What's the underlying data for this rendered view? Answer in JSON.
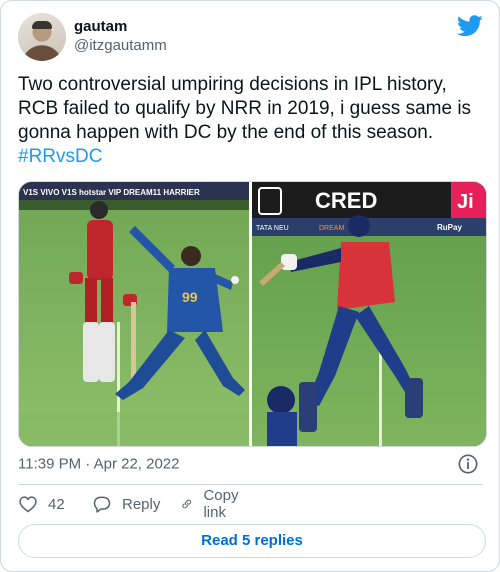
{
  "author": {
    "display_name": "gautam",
    "handle": "@itzgautamm"
  },
  "tweet": {
    "text": "Two controversial umpiring decisions in IPL history, RCB failed to qualify by NRR in 2019, i guess same is gonna happen with DC by the end of this season. ",
    "hashtag": "#RRvsDC"
  },
  "media": {
    "left_image": {
      "banner": "V1S VIVO V1S hotstar VIP DREAM11 HARRIER",
      "jersey_number": "99"
    },
    "right_image": {
      "sponsor": "CRED",
      "board_left": "TATA NEU",
      "board_mid": "DREAM",
      "board_right": "RuPay",
      "corner": "Ji"
    }
  },
  "meta": {
    "timestamp": "11:39 PM · Apr 22, 2022"
  },
  "actions": {
    "like_count": "42",
    "reply_label": "Reply",
    "copy_link_label": "Copy link"
  },
  "footer": {
    "read_replies_label": "Read 5 replies"
  },
  "colors": {
    "brand": "#1d9bf0",
    "link": "#006fd6",
    "muted": "#536471",
    "border": "#cfd9de"
  },
  "icons": {
    "brand": "twitter-bird-icon",
    "info": "info-icon",
    "like": "heart-icon",
    "reply": "reply-bubble-icon",
    "copy_link": "link-icon"
  }
}
